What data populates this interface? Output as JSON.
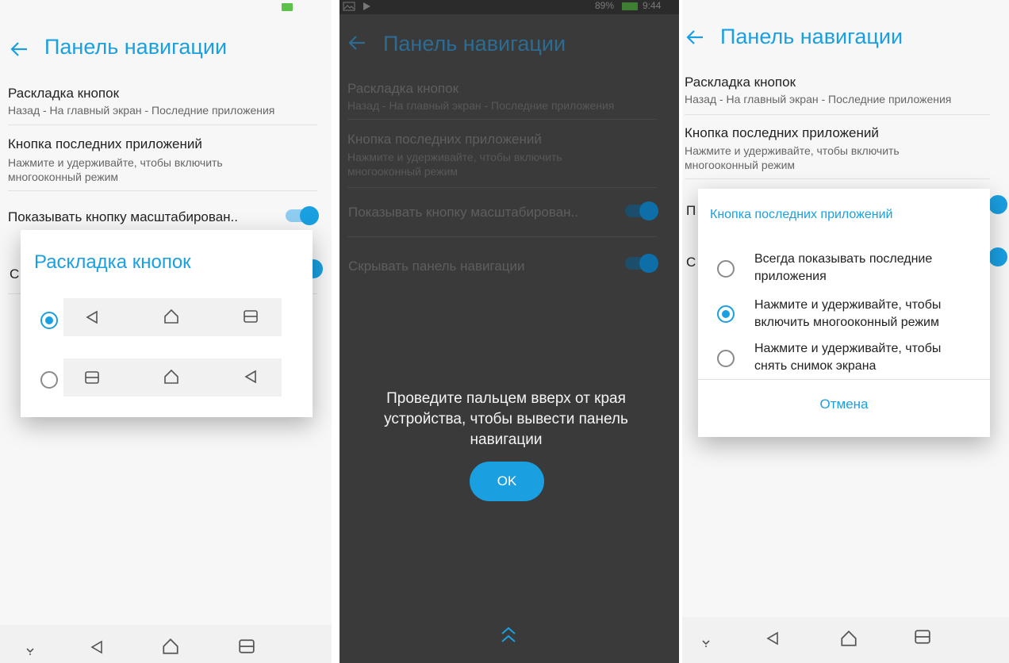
{
  "shared": {
    "screen_title": "Панель навигации",
    "button_layout_title": "Раскладка кнопок",
    "button_layout_value": "Назад - На главный экран - Последние приложения",
    "recent_button_title": "Кнопка последних приложений",
    "recent_button_value": "Нажмите и удерживайте, чтобы включить многооконный режим",
    "show_zoom_label": "Показывать кнопку масштабирован..",
    "hide_navbar_label": "Скрывать панель навигации"
  },
  "panel1": {
    "dialog_title": "Раскладка кнопок",
    "peek_letter": "С",
    "options": [
      {
        "selected": true,
        "buttons": [
          "back-icon",
          "home-icon",
          "recents-icon"
        ]
      },
      {
        "selected": false,
        "buttons": [
          "recents-icon",
          "home-icon",
          "back-icon"
        ]
      }
    ]
  },
  "panel2": {
    "status_bar": {
      "battery": "89%",
      "time": "9:44"
    },
    "overlay_message": "Проведите пальцем вверх от края устройства, чтобы вывести панель навигации",
    "ok_label": "OK"
  },
  "panel3": {
    "dialog_title": "Кнопка последних приложений",
    "peek_letter_1": "П",
    "peek_letter_2": "С",
    "options": [
      {
        "label": "Всегда показывать последние приложения",
        "selected": false
      },
      {
        "label": "Нажмите и удерживайте, чтобы включить многооконный режим",
        "selected": true
      },
      {
        "label": "Нажмите и удерживайте, чтобы снять снимок экрана",
        "selected": false
      }
    ],
    "cancel_label": "Отмена"
  },
  "colors": {
    "accent": "#1a9fe0",
    "dark_bg": "#3a3a3a",
    "light_bg": "#f7f7f7"
  },
  "icons": [
    "back-arrow-icon",
    "back-icon",
    "home-icon",
    "recents-icon",
    "keyboard-hide-icon",
    "swipe-up-icon",
    "battery-icon",
    "gallery-icon",
    "play-store-icon"
  ]
}
